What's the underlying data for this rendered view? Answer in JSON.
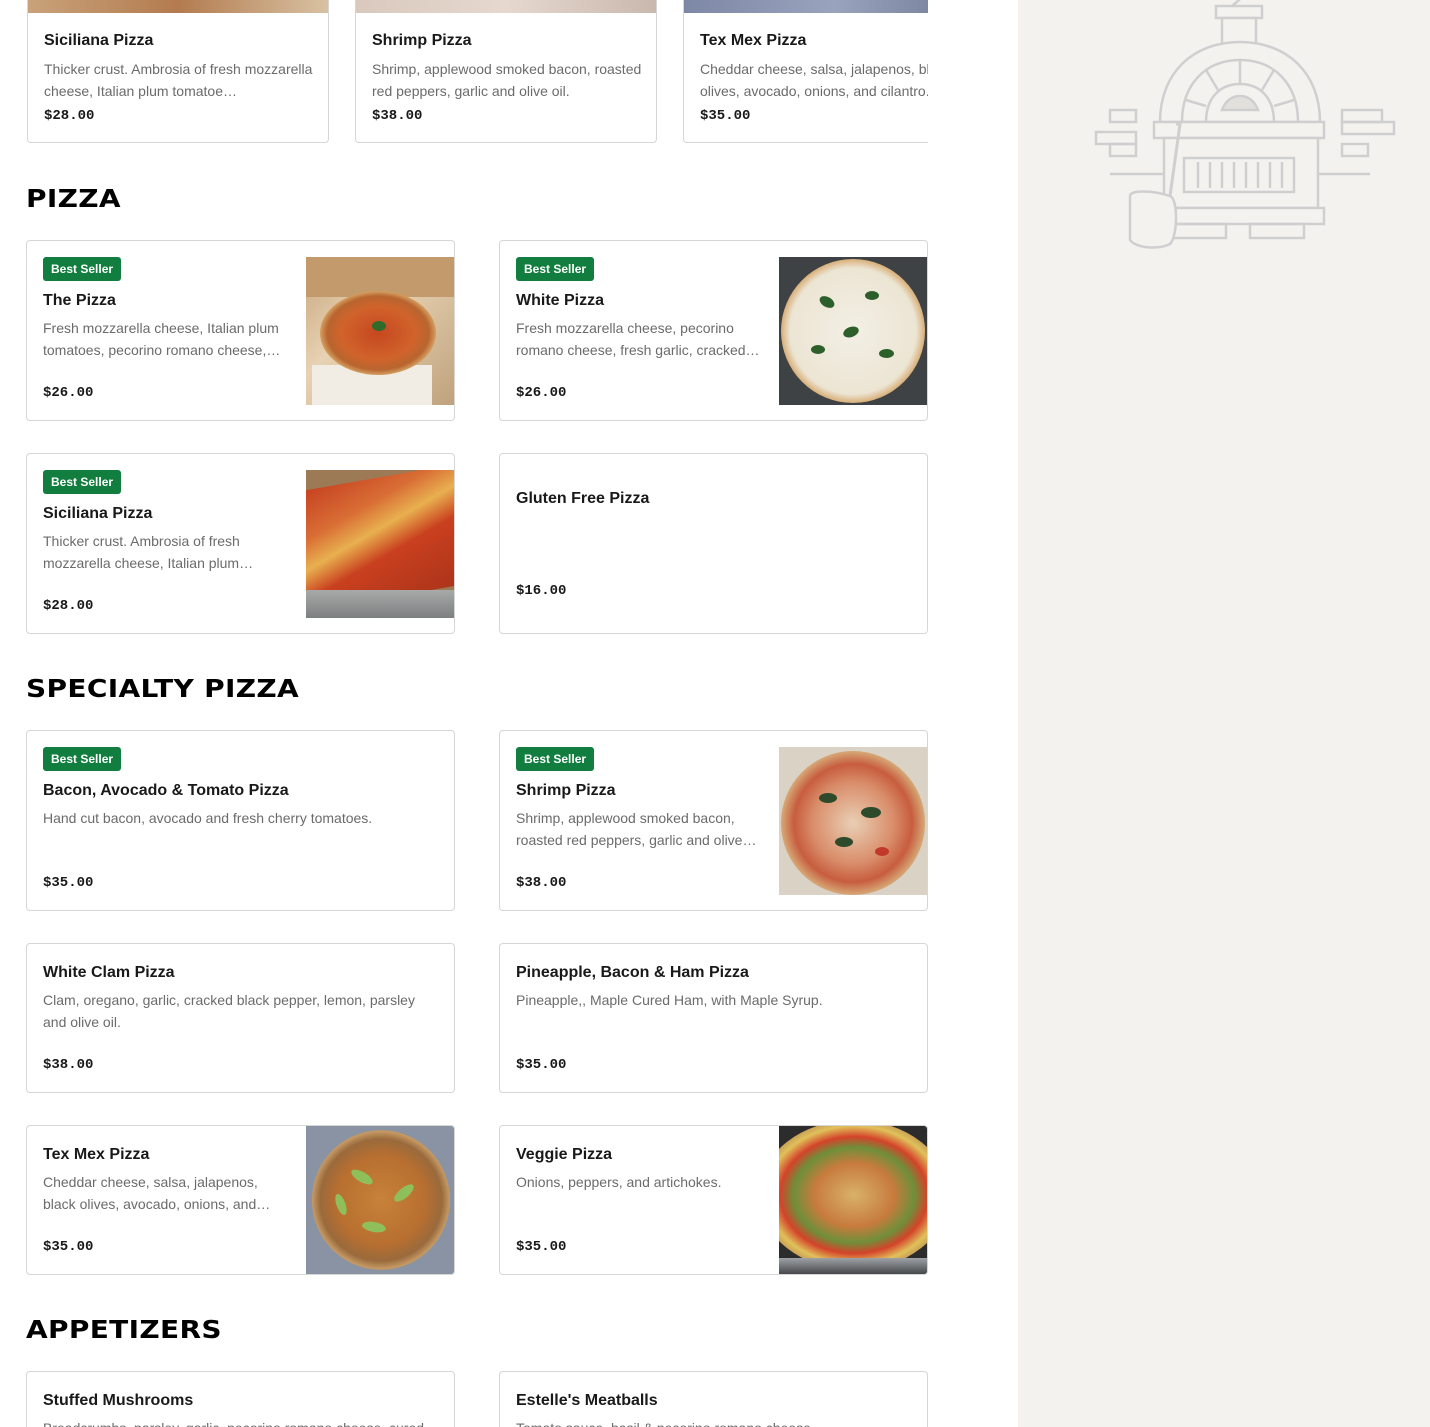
{
  "carousel": [
    {
      "title": "Siciliana Pizza",
      "desc": "Thicker crust. Ambrosia of fresh mozzarella cheese, Italian plum tomatoe…",
      "price": "$28.00"
    },
    {
      "title": "Shrimp Pizza",
      "desc": "Shrimp, applewood smoked bacon, roasted red peppers, garlic and olive oil.",
      "price": "$38.00"
    },
    {
      "title": "Tex Mex Pizza",
      "desc": "Cheddar cheese, salsa, jalapenos, black olives, avocado, onions, and cilantro.",
      "price": "$35.00"
    }
  ],
  "sections": {
    "pizza": "PIZZA",
    "specialty": "SPECIALTY PIZZA",
    "appetizers": "APPETIZERS"
  },
  "badge_label": "Best Seller",
  "pizza_items": [
    {
      "title": "The Pizza",
      "desc": "Fresh mozzarella cheese, Italian plum tomatoes, pecorino romano cheese,…",
      "price": "$26.00",
      "image": "pizza-in-box"
    },
    {
      "title": "White Pizza",
      "desc": "Fresh mozzarella cheese, pecorino romano cheese, fresh garlic, cracked…",
      "price": "$26.00",
      "image": "white-pizza"
    },
    {
      "title": "Siciliana Pizza",
      "desc": "Thicker crust. Ambrosia of fresh mozzarella cheese, Italian plum…",
      "price": "$28.00",
      "image": "siciliana-pizza"
    },
    {
      "title": "Gluten Free Pizza",
      "desc": "",
      "price": "$16.00"
    }
  ],
  "specialty_items": [
    {
      "title": "Bacon, Avocado & Tomato Pizza",
      "desc": "Hand cut bacon, avocado and fresh cherry tomatoes.",
      "price": "$35.00"
    },
    {
      "title": "Shrimp Pizza",
      "desc": "Shrimp, applewood smoked bacon, roasted red peppers, garlic and olive…",
      "price": "$38.00",
      "image": "shrimp-pizza"
    },
    {
      "title": "White Clam Pizza",
      "desc": "Clam, oregano, garlic, cracked black pepper, lemon, parsley and olive oil.",
      "price": "$38.00"
    },
    {
      "title": "Pineapple, Bacon & Ham Pizza",
      "desc": "Pineapple,, Maple Cured Ham, with Maple Syrup.",
      "price": "$35.00"
    },
    {
      "title": "Tex Mex Pizza",
      "desc": "Cheddar cheese, salsa, jalapenos, black olives, avocado, onions, and…",
      "price": "$35.00",
      "image": "tex-mex-pizza"
    },
    {
      "title": "Veggie Pizza",
      "desc": "Onions, peppers, and artichokes.",
      "price": "$35.00",
      "image": "veggie-pizza"
    }
  ],
  "appetizer_items": [
    {
      "title": "Stuffed Mushrooms",
      "desc": "Breadcrumbs, parsley, garlic, pecorino romano cheese, cured"
    },
    {
      "title": "Estelle's Meatballs",
      "desc": "Tomato sauce, basil & pecorino romano cheese."
    }
  ],
  "colors": {
    "badge": "#117e3f",
    "sidebar_bg": "#f3f2ef",
    "border": "#d6d6d6"
  },
  "illustration": "pizza-oven-icon"
}
